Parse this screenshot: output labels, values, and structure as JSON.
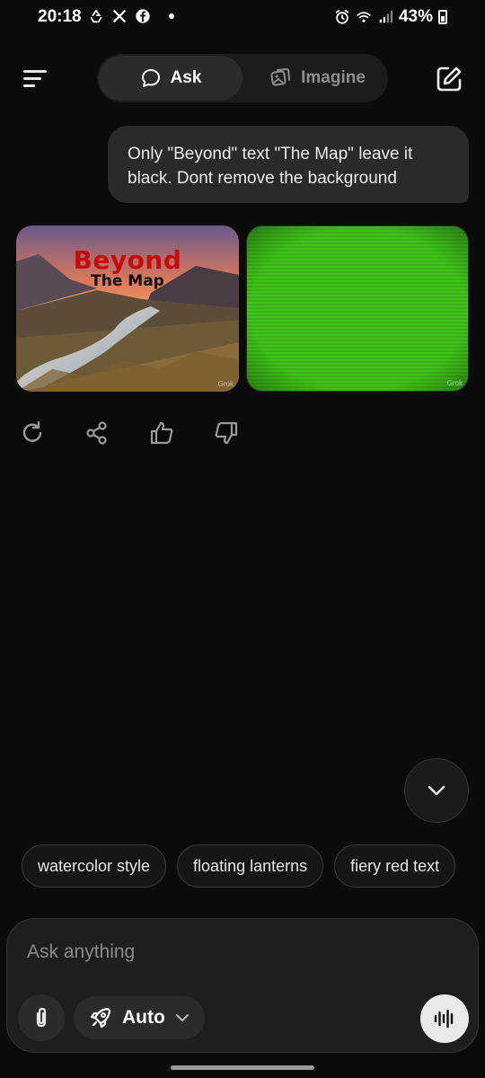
{
  "status_bar": {
    "time": "20:18",
    "battery_percent": "43%",
    "left_icons": [
      "recycle-icon",
      "x-icon",
      "facebook-icon",
      "dot-icon"
    ],
    "right_icons": [
      "alarm-icon",
      "wifi-icon",
      "signal-icon",
      "battery-icon"
    ]
  },
  "header": {
    "tabs": [
      {
        "label": "Ask",
        "icon": "chat-bubble-icon",
        "active": true
      },
      {
        "label": "Imagine",
        "icon": "imagine-icon",
        "active": false
      }
    ],
    "left_icon": "menu-icon",
    "right_icon": "new-chat-icon"
  },
  "conversation": {
    "user_message": "Only \"Beyond\" text \"The Map\" leave it black. Dont remove the background",
    "images": [
      {
        "kind": "landscape",
        "title_text": "Beyond",
        "subtitle_text": "The Map",
        "watermark": "Grok"
      },
      {
        "kind": "green-screen",
        "watermark": "Grok"
      }
    ],
    "actions": [
      "regenerate-icon",
      "share-icon",
      "thumbs-up-icon",
      "thumbs-down-icon"
    ]
  },
  "suggestions": [
    "watercolor style",
    "floating lanterns",
    "fiery red text"
  ],
  "composer": {
    "placeholder": "Ask anything",
    "value": "",
    "mode_label": "Auto"
  },
  "colors": {
    "background": "#0b0b0b",
    "bubble": "#2a2a2a",
    "title_red": "#c90a0a",
    "green_screen": "#3fc21a"
  }
}
